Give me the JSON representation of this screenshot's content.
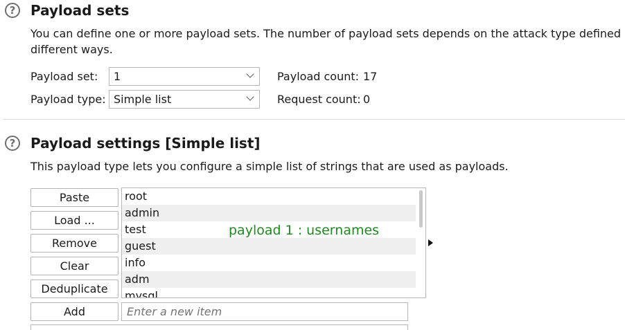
{
  "payload_sets": {
    "title": "Payload sets",
    "description_line1": "You can define one or more payload sets. The number of payload sets depends on the attack type defined in t",
    "description_line2": "different ways.",
    "set_label": "Payload set:",
    "set_value": "1",
    "type_label": "Payload type:",
    "type_value": "Simple list",
    "payload_count_label": "Payload count:",
    "payload_count_value": "17",
    "request_count_label": "Request count:",
    "request_count_value": "0"
  },
  "payload_settings": {
    "title": "Payload settings [Simple list]",
    "description": "This payload type lets you configure a simple list of strings that are used as payloads.",
    "buttons": {
      "paste": "Paste",
      "load": "Load ...",
      "remove": "Remove",
      "clear": "Clear",
      "deduplicate": "Deduplicate",
      "add": "Add"
    },
    "items": [
      "root",
      "admin",
      "test",
      "guest",
      "info",
      "adm",
      "mysql"
    ],
    "annotation": "payload 1 : usernames",
    "new_item_placeholder": "Enter a new item"
  },
  "icons": {
    "help": "help-icon",
    "dropdown": "chevron-down-icon",
    "expand": "arrow-right-icon"
  },
  "colors": {
    "annotation": "#1f8a1f",
    "list_alt_row": "#efefef"
  }
}
